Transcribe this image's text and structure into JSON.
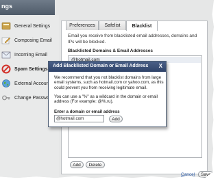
{
  "window": {
    "title_fragment": "ngs"
  },
  "sidebar": {
    "items": [
      {
        "label": "General Settings",
        "icon": "general-settings-icon"
      },
      {
        "label": "Composing Email",
        "icon": "pencil-icon"
      },
      {
        "label": "Incoming Email",
        "icon": "inbox-icon"
      },
      {
        "label": "Spam Settings",
        "icon": "no-entry-icon",
        "active": true
      },
      {
        "label": "External Accounts",
        "icon": "globe-icon"
      },
      {
        "label": "Change Password",
        "icon": "key-icon"
      }
    ]
  },
  "tabs": [
    {
      "label": "Preferences"
    },
    {
      "label": "Safelist"
    },
    {
      "label": "Blacklist",
      "active": true
    }
  ],
  "main": {
    "description": "Email you receive from blacklisted email addresses, domains and IPs will be blocked.",
    "list_title": "Blacklisted Domains & Email Addresses",
    "list_items": [
      "@hotmail.com"
    ],
    "add_label": "Add",
    "delete_label": "Delete"
  },
  "dialog": {
    "title": "Add Blacklisted Domain or Email Address",
    "close_label": "X",
    "paragraph1": "We recommend that you not blacklist domains from large email systems, such as hotmail.com or yahoo.com, as this could prevent you from receiving legitimate email.",
    "paragraph2": "You can use a \"%\" as a wildcard in the domain or email address (For example: @%.ru).",
    "field_label": "Enter a domain or email address",
    "field_value": "@hotmail.com",
    "add_label": "Add"
  },
  "footer": {
    "cancel_label": "Cancel",
    "save_label": "Save"
  },
  "colors": {
    "dialog_header": "#3a5078",
    "titlebar": "#5f6b79",
    "panel_bg": "#e6e7e7",
    "spam_icon": "#d2332c"
  }
}
